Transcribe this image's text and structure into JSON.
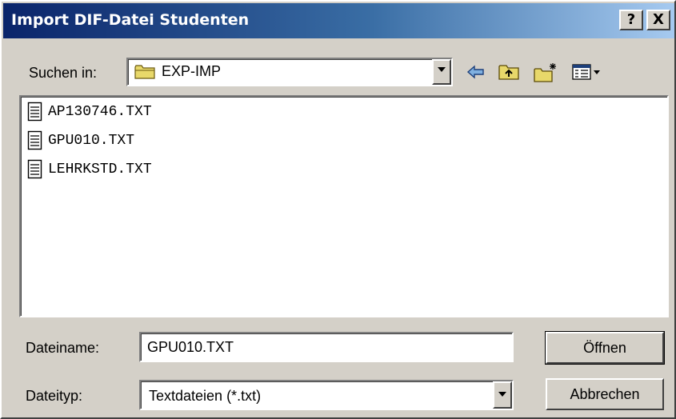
{
  "window": {
    "title": "Import DIF-Datei Studenten",
    "help_glyph": "?",
    "close_glyph": "X"
  },
  "toolbar": {
    "look_in_label": "Suchen in:",
    "folder_name": "EXP-IMP",
    "folder_icon": "folder-icon",
    "back_icon": "back-arrow-icon",
    "up_icon": "up-folder-icon",
    "new_folder_icon": "new-folder-icon",
    "view_menu_icon": "view-menu-icon"
  },
  "files": [
    {
      "name": "AP130746.TXT",
      "icon": "text-file-icon"
    },
    {
      "name": "GPU010.TXT",
      "icon": "text-file-icon"
    },
    {
      "name": "LEHRKSTD.TXT",
      "icon": "text-file-icon"
    }
  ],
  "filename": {
    "label": "Dateiname:",
    "value": "GPU010.TXT"
  },
  "filetype": {
    "label": "Dateityp:",
    "value": "Textdateien (*.txt)"
  },
  "buttons": {
    "open": "Öffnen",
    "cancel": "Abbrechen"
  },
  "colors": {
    "titlebar_start": "#0a246a",
    "titlebar_end": "#a6caf0",
    "dialog_face": "#d4d0c8"
  }
}
